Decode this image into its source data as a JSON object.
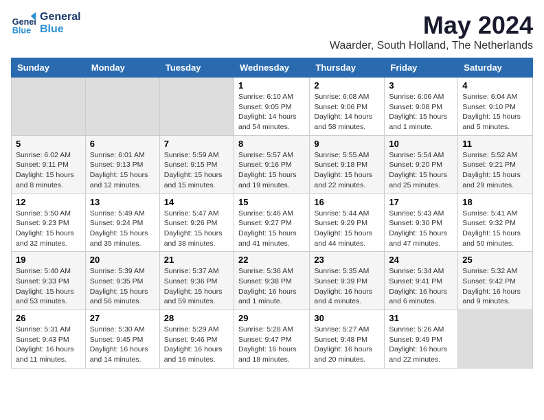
{
  "header": {
    "logo_line1": "General",
    "logo_line2": "Blue",
    "month": "May 2024",
    "location": "Waarder, South Holland, The Netherlands"
  },
  "weekdays": [
    "Sunday",
    "Monday",
    "Tuesday",
    "Wednesday",
    "Thursday",
    "Friday",
    "Saturday"
  ],
  "weeks": [
    [
      {
        "day": "",
        "info": ""
      },
      {
        "day": "",
        "info": ""
      },
      {
        "day": "",
        "info": ""
      },
      {
        "day": "1",
        "info": "Sunrise: 6:10 AM\nSunset: 9:05 PM\nDaylight: 14 hours\nand 54 minutes."
      },
      {
        "day": "2",
        "info": "Sunrise: 6:08 AM\nSunset: 9:06 PM\nDaylight: 14 hours\nand 58 minutes."
      },
      {
        "day": "3",
        "info": "Sunrise: 6:06 AM\nSunset: 9:08 PM\nDaylight: 15 hours\nand 1 minute."
      },
      {
        "day": "4",
        "info": "Sunrise: 6:04 AM\nSunset: 9:10 PM\nDaylight: 15 hours\nand 5 minutes."
      }
    ],
    [
      {
        "day": "5",
        "info": "Sunrise: 6:02 AM\nSunset: 9:11 PM\nDaylight: 15 hours\nand 8 minutes."
      },
      {
        "day": "6",
        "info": "Sunrise: 6:01 AM\nSunset: 9:13 PM\nDaylight: 15 hours\nand 12 minutes."
      },
      {
        "day": "7",
        "info": "Sunrise: 5:59 AM\nSunset: 9:15 PM\nDaylight: 15 hours\nand 15 minutes."
      },
      {
        "day": "8",
        "info": "Sunrise: 5:57 AM\nSunset: 9:16 PM\nDaylight: 15 hours\nand 19 minutes."
      },
      {
        "day": "9",
        "info": "Sunrise: 5:55 AM\nSunset: 9:18 PM\nDaylight: 15 hours\nand 22 minutes."
      },
      {
        "day": "10",
        "info": "Sunrise: 5:54 AM\nSunset: 9:20 PM\nDaylight: 15 hours\nand 25 minutes."
      },
      {
        "day": "11",
        "info": "Sunrise: 5:52 AM\nSunset: 9:21 PM\nDaylight: 15 hours\nand 29 minutes."
      }
    ],
    [
      {
        "day": "12",
        "info": "Sunrise: 5:50 AM\nSunset: 9:23 PM\nDaylight: 15 hours\nand 32 minutes."
      },
      {
        "day": "13",
        "info": "Sunrise: 5:49 AM\nSunset: 9:24 PM\nDaylight: 15 hours\nand 35 minutes."
      },
      {
        "day": "14",
        "info": "Sunrise: 5:47 AM\nSunset: 9:26 PM\nDaylight: 15 hours\nand 38 minutes."
      },
      {
        "day": "15",
        "info": "Sunrise: 5:46 AM\nSunset: 9:27 PM\nDaylight: 15 hours\nand 41 minutes."
      },
      {
        "day": "16",
        "info": "Sunrise: 5:44 AM\nSunset: 9:29 PM\nDaylight: 15 hours\nand 44 minutes."
      },
      {
        "day": "17",
        "info": "Sunrise: 5:43 AM\nSunset: 9:30 PM\nDaylight: 15 hours\nand 47 minutes."
      },
      {
        "day": "18",
        "info": "Sunrise: 5:41 AM\nSunset: 9:32 PM\nDaylight: 15 hours\nand 50 minutes."
      }
    ],
    [
      {
        "day": "19",
        "info": "Sunrise: 5:40 AM\nSunset: 9:33 PM\nDaylight: 15 hours\nand 53 minutes."
      },
      {
        "day": "20",
        "info": "Sunrise: 5:39 AM\nSunset: 9:35 PM\nDaylight: 15 hours\nand 56 minutes."
      },
      {
        "day": "21",
        "info": "Sunrise: 5:37 AM\nSunset: 9:36 PM\nDaylight: 15 hours\nand 59 minutes."
      },
      {
        "day": "22",
        "info": "Sunrise: 5:36 AM\nSunset: 9:38 PM\nDaylight: 16 hours\nand 1 minute."
      },
      {
        "day": "23",
        "info": "Sunrise: 5:35 AM\nSunset: 9:39 PM\nDaylight: 16 hours\nand 4 minutes."
      },
      {
        "day": "24",
        "info": "Sunrise: 5:34 AM\nSunset: 9:41 PM\nDaylight: 16 hours\nand 6 minutes."
      },
      {
        "day": "25",
        "info": "Sunrise: 5:32 AM\nSunset: 9:42 PM\nDaylight: 16 hours\nand 9 minutes."
      }
    ],
    [
      {
        "day": "26",
        "info": "Sunrise: 5:31 AM\nSunset: 9:43 PM\nDaylight: 16 hours\nand 11 minutes."
      },
      {
        "day": "27",
        "info": "Sunrise: 5:30 AM\nSunset: 9:45 PM\nDaylight: 16 hours\nand 14 minutes."
      },
      {
        "day": "28",
        "info": "Sunrise: 5:29 AM\nSunset: 9:46 PM\nDaylight: 16 hours\nand 16 minutes."
      },
      {
        "day": "29",
        "info": "Sunrise: 5:28 AM\nSunset: 9:47 PM\nDaylight: 16 hours\nand 18 minutes."
      },
      {
        "day": "30",
        "info": "Sunrise: 5:27 AM\nSunset: 9:48 PM\nDaylight: 16 hours\nand 20 minutes."
      },
      {
        "day": "31",
        "info": "Sunrise: 5:26 AM\nSunset: 9:49 PM\nDaylight: 16 hours\nand 22 minutes."
      },
      {
        "day": "",
        "info": ""
      }
    ]
  ]
}
